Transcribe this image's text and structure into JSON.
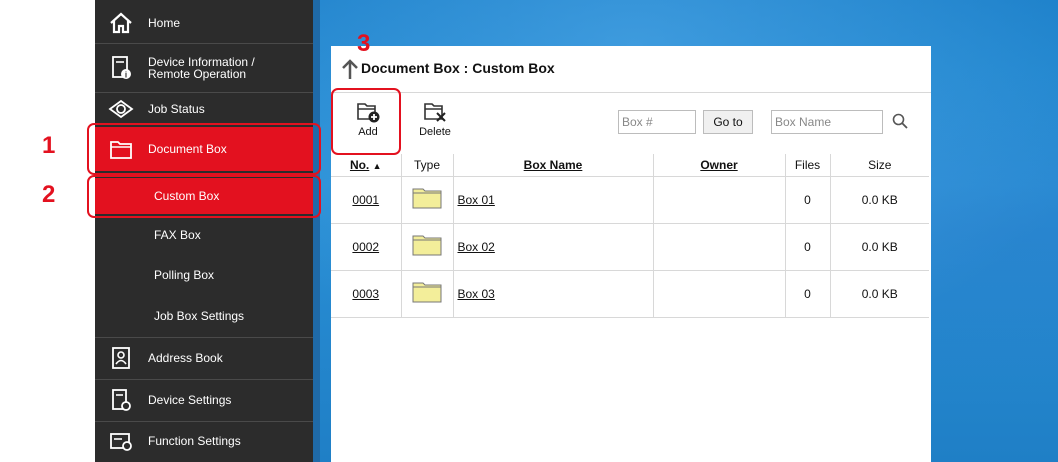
{
  "sidebar": {
    "items": [
      {
        "label": "Home",
        "icon": "home-icon"
      },
      {
        "label": "Device Information /\nRemote Operation",
        "icon": "device-info-icon"
      },
      {
        "label": "Job Status",
        "icon": "job-status-icon"
      },
      {
        "label": "Document Box",
        "icon": "folder-icon"
      },
      {
        "label": "Address Book",
        "icon": "address-book-icon"
      },
      {
        "label": "Device Settings",
        "icon": "device-settings-icon"
      },
      {
        "label": "Function Settings",
        "icon": "function-settings-icon"
      }
    ],
    "sub_items": [
      "Custom Box",
      "FAX Box",
      "Polling Box",
      "Job Box Settings"
    ]
  },
  "callouts": [
    "1",
    "2",
    "3"
  ],
  "panel": {
    "title": "Document Box : Custom Box",
    "toolbar": {
      "add_label": "Add",
      "delete_label": "Delete",
      "box_number_placeholder": "Box #",
      "goto_label": "Go to",
      "box_name_placeholder": "Box Name"
    },
    "table": {
      "headers": [
        "No.",
        "Type",
        "Box Name",
        "Owner",
        "Files",
        "Size"
      ],
      "sort_indicator": "▲",
      "rows": [
        {
          "no": "0001",
          "name": "Box 01",
          "owner": "",
          "files": "0",
          "size": "0.0 KB"
        },
        {
          "no": "0002",
          "name": "Box 02",
          "owner": "",
          "files": "0",
          "size": "0.0 KB"
        },
        {
          "no": "0003",
          "name": "Box 03",
          "owner": "",
          "files": "0",
          "size": "0.0 KB"
        }
      ]
    }
  },
  "colors": {
    "accent_red": "#e3111f",
    "sidebar_bg": "#2c2c2c",
    "folder_fill": "#f3ee9a"
  }
}
